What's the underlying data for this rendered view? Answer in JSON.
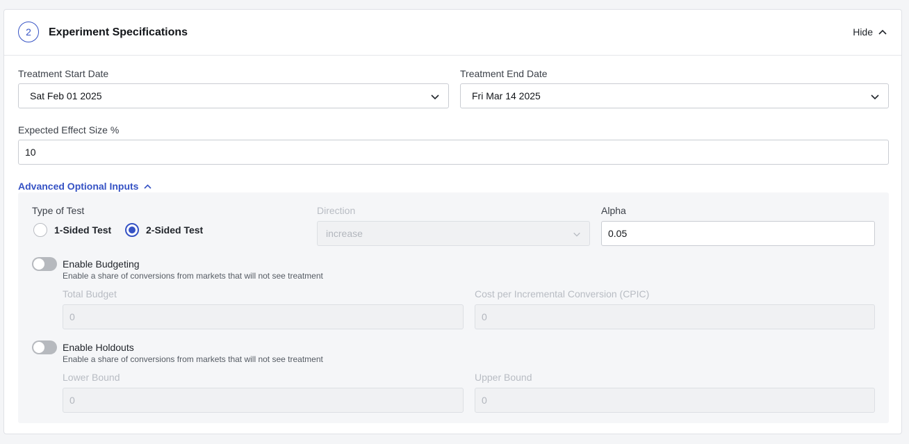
{
  "header": {
    "step_number": "2",
    "title": "Experiment Specifications",
    "hide_label": "Hide"
  },
  "treatment_start": {
    "label": "Treatment Start Date",
    "value": "Sat Feb 01 2025"
  },
  "treatment_end": {
    "label": "Treatment End Date",
    "value": "Fri Mar 14 2025"
  },
  "effect_size": {
    "label": "Expected Effect Size %",
    "value": "10"
  },
  "advanced": {
    "link_label": "Advanced Optional Inputs",
    "type_of_test": {
      "label": "Type of Test",
      "options": [
        "1-Sided Test",
        "2-Sided Test"
      ],
      "selected": "2-Sided Test"
    },
    "direction": {
      "label": "Direction",
      "value": "increase"
    },
    "alpha": {
      "label": "Alpha",
      "value": "0.05"
    },
    "budgeting": {
      "title": "Enable Budgeting",
      "description": "Enable a share of conversions from markets that will not see treatment",
      "enabled": false,
      "total_budget_label": "Total Budget",
      "total_budget_value": "0",
      "cpic_label": "Cost per Incremental Conversion (CPIC)",
      "cpic_value": "0"
    },
    "holdouts": {
      "title": "Enable Holdouts",
      "description": "Enable a share of conversions from markets that will not see treatment",
      "enabled": false,
      "lower_bound_label": "Lower Bound",
      "lower_bound_value": "0",
      "upper_bound_label": "Upper Bound",
      "upper_bound_value": "0"
    }
  },
  "colors": {
    "accent": "#3552c4",
    "toggle_off": "#b6b9be",
    "panel_bg": "#f5f6f8"
  }
}
